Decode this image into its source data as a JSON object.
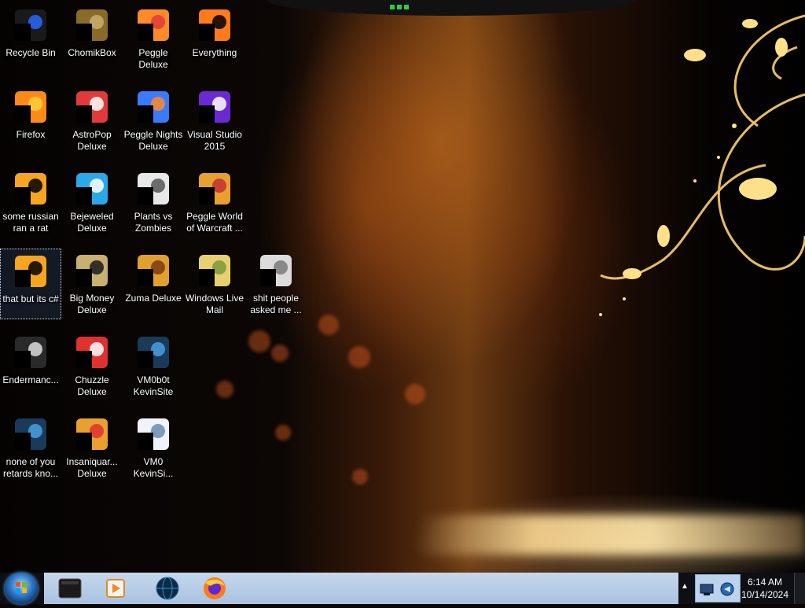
{
  "desktop": {
    "icons": [
      {
        "label": "Recycle Bin",
        "icon": "recycle-bin-icon"
      },
      {
        "label": "ChomikBox",
        "icon": "chomikbox-icon"
      },
      {
        "label": "Peggle Deluxe",
        "icon": "peggle-icon"
      },
      {
        "label": "Everything",
        "icon": "everything-search-icon"
      },
      {
        "label": "Firefox",
        "icon": "firefox-icon"
      },
      {
        "label": "AstroPop Deluxe",
        "icon": "astropop-icon"
      },
      {
        "label": "Peggle Nights Deluxe",
        "icon": "peggle-nights-icon"
      },
      {
        "label": "Visual Studio 2015",
        "icon": "visual-studio-icon"
      },
      {
        "label": "some russian ran a rat",
        "icon": "shortcut-app-icon"
      },
      {
        "label": "Bejeweled Deluxe",
        "icon": "bejeweled-icon"
      },
      {
        "label": "Plants vs Zombies",
        "icon": "plants-vs-zombies-icon"
      },
      {
        "label": "Peggle World of Warcraft ...",
        "icon": "peggle-wow-icon"
      },
      {
        "label": "that but its c#",
        "icon": "shortcut-app-icon"
      },
      {
        "label": "Big Money Deluxe",
        "icon": "big-money-icon"
      },
      {
        "label": "Zuma Deluxe",
        "icon": "zuma-icon"
      },
      {
        "label": "Windows Live Mail",
        "icon": "windows-live-mail-icon"
      },
      {
        "label": "shit people asked me ...",
        "icon": "folder-icon"
      },
      {
        "label": "Endermanc...",
        "icon": "window-app-icon"
      },
      {
        "label": "Chuzzle Deluxe",
        "icon": "chuzzle-icon"
      },
      {
        "label": "VM0b0t KevinSite",
        "icon": "app-icon"
      },
      {
        "label": "none of you retards kno...",
        "icon": "app-icon"
      },
      {
        "label": "Insaniquar... Deluxe",
        "icon": "insaniquarium-icon"
      },
      {
        "label": "VM0 KevinSi...",
        "icon": "document-icon"
      }
    ]
  },
  "taskbar": {
    "start_label": "Start",
    "pinned": [
      {
        "name": "pinned-app-dark",
        "icon": "terminal-icon"
      },
      {
        "name": "pinned-media-player",
        "icon": "media-player-icon"
      },
      {
        "name": "pinned-globe-app",
        "icon": "globe-icon"
      },
      {
        "name": "pinned-firefox",
        "icon": "firefox-icon"
      }
    ],
    "clock_time": "6:14 AM",
    "clock_date": "10/14/2024",
    "tray_arrow": "▲"
  },
  "colors": {
    "label_text": "#ffffff",
    "taskbar_bg": "#b7cde8",
    "accent_orange": "#e07a20"
  }
}
